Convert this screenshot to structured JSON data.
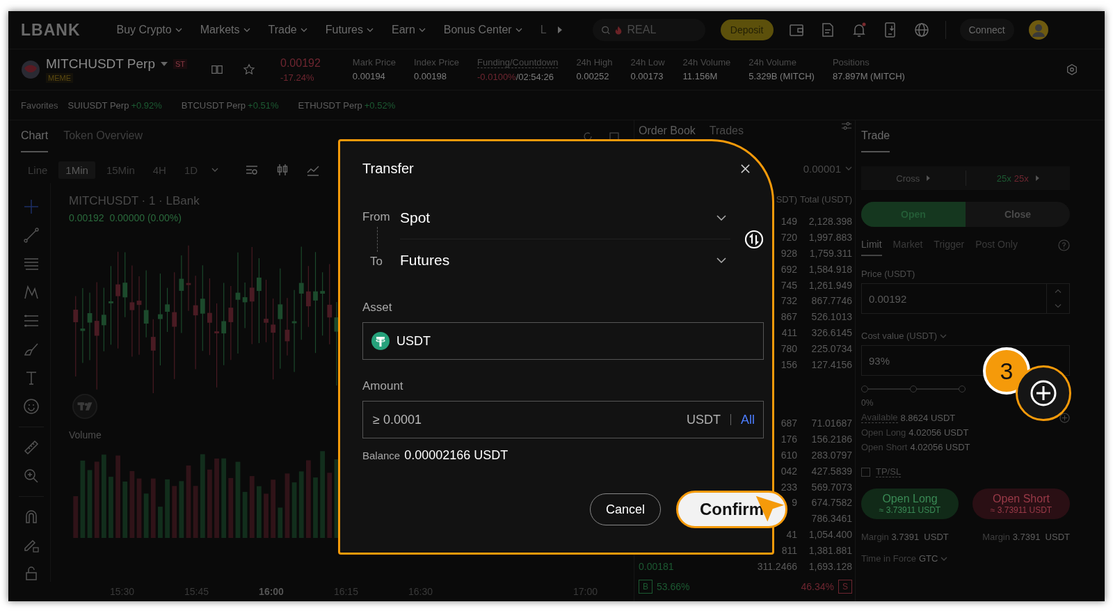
{
  "nav": {
    "logo": "LBANK",
    "menu": [
      "Buy Crypto",
      "Markets",
      "Trade",
      "Futures",
      "Earn",
      "Bonus Center"
    ],
    "overflow_item": "L",
    "search": {
      "placeholder": "REAL"
    },
    "deposit": "Deposit",
    "connect": "Connect"
  },
  "ticker": {
    "symbol": "MITCHUSDT Perp",
    "tag": "ST",
    "category": "MEME",
    "price": "0.00192",
    "change": "-17.24%",
    "stats": [
      {
        "label": "Mark Price",
        "value": "0.00194"
      },
      {
        "label": "Index Price",
        "value": "0.00198"
      },
      {
        "label": "Funding/Countdown",
        "value": "-0.0100%",
        "countdown": "/02:54:26"
      },
      {
        "label": "24h High",
        "value": "0.00252"
      },
      {
        "label": "24h Low",
        "value": "0.00173"
      },
      {
        "label": "24h Volume",
        "value": "11.156M"
      },
      {
        "label": "24h Volume",
        "value": "5.329B (MITCH)"
      },
      {
        "label": "Positions",
        "value": "87.897M (MITCH)"
      }
    ]
  },
  "favorites": {
    "label": "Favorites",
    "items": [
      {
        "symbol": "SUIUSDT Perp",
        "change": "+0.92%"
      },
      {
        "symbol": "BTCUSDT Perp",
        "change": "+0.51%"
      },
      {
        "symbol": "ETHUSDT Perp",
        "change": "+0.52%"
      }
    ]
  },
  "chart_panel": {
    "tabs": [
      {
        "label": "Chart",
        "selected": true
      },
      {
        "label": "Token Overview",
        "selected": false
      }
    ],
    "intervals": [
      {
        "label": "Line",
        "selected": false
      },
      {
        "label": "1Min",
        "selected": true
      },
      {
        "label": "15Min",
        "selected": false
      },
      {
        "label": "4H",
        "selected": false
      },
      {
        "label": "1D",
        "selected": false
      }
    ],
    "title": "MITCHUSDT · 1 · LBank",
    "ohlc": "0.00192  0.00000 (0.00%)",
    "volume_label": "Volume",
    "times": [
      "15:30",
      "15:45",
      "16:00",
      "16:15",
      "16:30",
      "17:00"
    ]
  },
  "order_book": {
    "tabs": [
      {
        "label": "Order Book",
        "selected": true
      },
      {
        "label": "Trades",
        "selected": false
      }
    ],
    "precision": "0.00001",
    "column_2": "SDT)",
    "column_3": "Total (USDT)",
    "asks": [
      {
        "amount": "149",
        "total": "2,128.398"
      },
      {
        "amount": "720",
        "total": "1,997.883"
      },
      {
        "amount": "928",
        "total": "1,759.311"
      },
      {
        "amount": "692",
        "total": "1,584.918"
      },
      {
        "amount": "745",
        "total": "1,261.949"
      },
      {
        "amount": "732",
        "total": "867.7746"
      },
      {
        "amount": "867",
        "total": "526.1013"
      },
      {
        "amount": "411",
        "total": "326.6145"
      },
      {
        "amount": "780",
        "total": "225.0734"
      },
      {
        "amount": "156",
        "total": "127.4156"
      }
    ],
    "bids": [
      {
        "amount": "687",
        "total": "71.01687"
      },
      {
        "amount": "176",
        "total": "156.2186"
      },
      {
        "amount": "610",
        "total": "283.0797"
      },
      {
        "amount": "042",
        "total": "427.5839"
      },
      {
        "amount": "233",
        "total": "569.7073"
      },
      {
        "amount": "9",
        "total": "674.7582"
      },
      {
        "total": "786.3461"
      },
      {
        "amount": "41",
        "total": "1,054.400"
      },
      {
        "amount": "811",
        "total": "1,381.881"
      },
      {
        "price": "0.00181",
        "amount": "311.2466",
        "total": "1,693.128"
      }
    ],
    "buy_label": "B",
    "buy_ratio": "53.66%",
    "sell_ratio": "46.34%",
    "sell_label": "S"
  },
  "trade": {
    "title": "Trade",
    "margin_mode": "Cross",
    "leverage_long": "25x",
    "leverage_short": "25x",
    "sides": [
      {
        "label": "Open",
        "selected": true
      },
      {
        "label": "Close",
        "selected": false
      }
    ],
    "order_types": [
      {
        "label": "Limit",
        "selected": true
      },
      {
        "label": "Market",
        "selected": false
      },
      {
        "label": "Trigger",
        "selected": false
      },
      {
        "label": "Post Only",
        "selected": false
      }
    ],
    "price_label": "Price (USDT)",
    "price": "0.00192",
    "cost_label": "Cost value (USDT)",
    "cost": "93%",
    "slider": {
      "level": 0,
      "label": "0%"
    },
    "info": [
      {
        "label": "Available",
        "value": "8.8624 USDT"
      },
      {
        "label": "Open Long",
        "value": "4.02056 USDT"
      },
      {
        "label": "Open Short",
        "value": "4.02056 USDT"
      }
    ],
    "tpsl": {
      "label": "TP/SL",
      "checked": false
    },
    "long_button": {
      "label": "Open Long",
      "sub": "≈ 3.73911 USDT"
    },
    "short_button": {
      "label": "Open Short",
      "sub": "≈ 3.73911 USDT"
    },
    "margins": [
      {
        "label": "Margin",
        "value": "3.7391  USDT"
      },
      {
        "label": "Margin",
        "value": "3.7391  USDT"
      }
    ],
    "tif_label": "Time in Force",
    "tif": "GTC"
  },
  "modal": {
    "title": "Transfer",
    "from_label": "From",
    "from": "Spot",
    "to_label": "To",
    "to": "Futures",
    "asset_label": "Asset",
    "asset": "USDT",
    "amount_label": "Amount",
    "amount_placeholder": "≥ 0.0001",
    "amount_unit": "USDT",
    "all": "All",
    "balance_label": "Balance",
    "balance": "0.00002166 USDT",
    "cancel": "Cancel",
    "confirm": {
      "label": "Confirm",
      "highlighted": true
    }
  },
  "annotation": {
    "step": "3"
  }
}
